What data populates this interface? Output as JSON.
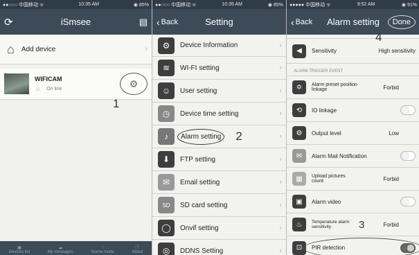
{
  "left": {
    "status_carrier": "●●○○○ 中国移动 ᯤ",
    "status_time": "10:35 AM",
    "status_battery": "◉ 85%",
    "title": "iSmsee",
    "add_device": "Add device",
    "camera_name": "WIFICAM",
    "camera_status": "On line",
    "annotation": "1",
    "tabs": [
      "Devices list",
      "My messages",
      "Scene mode",
      "About"
    ]
  },
  "middle": {
    "status_carrier": "●●○○○ 中国移动 ᯤ",
    "status_time": "10:35 AM",
    "status_battery": "◉ 85%",
    "back": "Back",
    "title": "Setting",
    "items": [
      "Device Information",
      "WI-FI setting",
      "User setting",
      "Device time setting",
      "Alarm setting",
      "FTP setting",
      "Email setting",
      "SD card setting",
      "Onvif setting",
      "DDNS Setting"
    ],
    "annotation": "2"
  },
  "right": {
    "status_carrier": "●●●●● 中国移动 ᯤ",
    "status_time": "9:52 AM",
    "status_battery": "◉ 91%",
    "back": "Back",
    "title": "Alarm setting",
    "done": "Done",
    "annotation_done": "4",
    "sensitivity_label": "Sensitivity",
    "sensitivity_value": "High sensitivity",
    "section_header": "ALARM TRIGGER EVENT",
    "preset_label": "Alarm preset position linkage",
    "preset_value": "Forbid",
    "io_label": "IO linkage",
    "output_label": "Output level",
    "output_value": "Low",
    "mail_label": "Alarm Mail Notification",
    "upload_label": "Upload pictures count",
    "upload_value": "Forbid",
    "video_label": "Alarm video",
    "temp_label": "Temperature alarm sensitivity",
    "temp_value": "Forbid",
    "annotation_temp": "3",
    "pir_label": "PIR detection"
  }
}
